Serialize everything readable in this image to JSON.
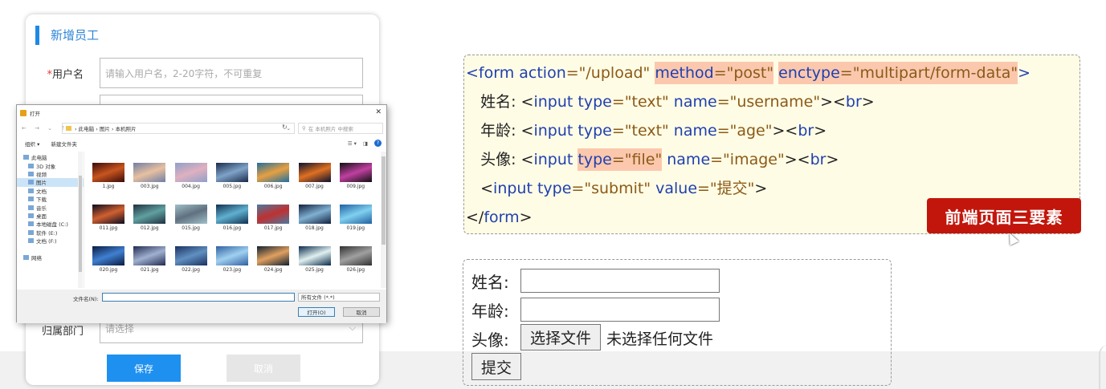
{
  "left_form": {
    "title": "新增员工",
    "username_required": "*",
    "username_label": "用户名",
    "username_placeholder": "请输入用户名，2-20字符，不可重复",
    "dept_label": "归属部门",
    "dept_placeholder": "请选择",
    "save_label": "保存",
    "cancel_label": "取消"
  },
  "dialog": {
    "title": "打开",
    "close": "✕",
    "nav_arrows": "← → ⌄ ↑",
    "breadcrumb": "› 此电脑 › 图片 › 本机照片",
    "search_placeholder": "在 本机照片 中搜索",
    "toolbar_organize": "组织 ▾",
    "toolbar_newfolder": "新建文件夹",
    "sidebar": [
      {
        "label": "此电脑",
        "top": true,
        "sel": false
      },
      {
        "label": "3D 对象",
        "top": false,
        "sel": false
      },
      {
        "label": "视频",
        "top": false,
        "sel": false
      },
      {
        "label": "图片",
        "top": false,
        "sel": true
      },
      {
        "label": "文档",
        "top": false,
        "sel": false
      },
      {
        "label": "下载",
        "top": false,
        "sel": false
      },
      {
        "label": "音乐",
        "top": false,
        "sel": false
      },
      {
        "label": "桌面",
        "top": false,
        "sel": false
      },
      {
        "label": "本地磁盘 (C:)",
        "top": false,
        "sel": false
      },
      {
        "label": "软件 (E:)",
        "top": false,
        "sel": false
      },
      {
        "label": "文档 (F:)",
        "top": false,
        "sel": false
      },
      {
        "label": "",
        "top": false,
        "sel": false
      },
      {
        "label": "网络",
        "top": true,
        "sel": false
      }
    ],
    "files": [
      {
        "name": "1.jpg",
        "colors": [
          "#3a0a0a",
          "#c8551e"
        ]
      },
      {
        "name": "003.jpg",
        "colors": [
          "#6f7fa6",
          "#e8c0a0"
        ]
      },
      {
        "name": "004.jpg",
        "colors": [
          "#8fa0c8",
          "#e0b0c0"
        ]
      },
      {
        "name": "005.jpg",
        "colors": [
          "#1a2a4a",
          "#7fa3c8"
        ]
      },
      {
        "name": "006.jpg",
        "colors": [
          "#1e6fa0",
          "#e8a040"
        ]
      },
      {
        "name": "007.jpg",
        "colors": [
          "#0a1030",
          "#e07020"
        ]
      },
      {
        "name": "009.jpg",
        "colors": [
          "#101010",
          "#c040a0"
        ]
      },
      {
        "name": "011.jpg",
        "colors": [
          "#0a0a20",
          "#d06030"
        ]
      },
      {
        "name": "012.jpg",
        "colors": [
          "#203040",
          "#60a0a0"
        ]
      },
      {
        "name": "015.jpg",
        "colors": [
          "#a0c0c8",
          "#607080"
        ]
      },
      {
        "name": "016.jpg",
        "colors": [
          "#103050",
          "#60b0d0"
        ]
      },
      {
        "name": "017.jpg",
        "colors": [
          "#4a7aa0",
          "#c03030"
        ]
      },
      {
        "name": "018.jpg",
        "colors": [
          "#102040",
          "#80b0d0"
        ]
      },
      {
        "name": "019.jpg",
        "colors": [
          "#2060a0",
          "#80d0f0"
        ]
      },
      {
        "name": "020.jpg",
        "colors": [
          "#0a1a40",
          "#4080d0"
        ]
      },
      {
        "name": "021.jpg",
        "colors": [
          "#202a50",
          "#a0b0d0"
        ]
      },
      {
        "name": "022.jpg",
        "colors": [
          "#1a3060",
          "#6090c0"
        ]
      },
      {
        "name": "023.jpg",
        "colors": [
          "#3060a0",
          "#a0d0f0"
        ]
      },
      {
        "name": "024.jpg",
        "colors": [
          "#102030",
          "#e0a060"
        ]
      },
      {
        "name": "025.jpg",
        "colors": [
          "#0a2a4a",
          "#e0f0f0"
        ]
      },
      {
        "name": "026.jpg",
        "colors": [
          "#303030",
          "#a0a0a0"
        ]
      }
    ],
    "filename_label": "文件名(N):",
    "filetype": "所有文件 (*.*)",
    "open_label": "打开(O)",
    "cancel_label": "取消"
  },
  "code": {
    "l1": {
      "p1": "<form ",
      "p2": "action",
      "p3": "=\"/upload\" ",
      "p4": "method",
      "p5": "=\"post\"",
      "p6": " ",
      "p7": "enctype",
      "p8": "=\"multipart/form-data\"",
      "p9": ">"
    },
    "l2": {
      "p1": "   姓名: <",
      "p2": "input ",
      "p3": "type",
      "p4": "=\"text\" ",
      "p5": "name",
      "p6": "=\"username\"",
      "p7": "><",
      "p8": "br",
      "p9": ">"
    },
    "l3": {
      "p1": "   年龄: <",
      "p2": "input ",
      "p3": "type",
      "p4": "=\"text\" ",
      "p5": "name",
      "p6": "=\"age\"",
      "p7": "><",
      "p8": "br",
      "p9": ">"
    },
    "l4": {
      "p1": "   头像: <",
      "p2": "input ",
      "p3": "type",
      "p4": "=\"file\"",
      "p5": " ",
      "p6": "name",
      "p7": "=\"image\"",
      "p8": "><",
      "p9": "br",
      "p10": ">"
    },
    "l5": {
      "p1": "   <",
      "p2": "input ",
      "p3": "type",
      "p4": "=\"submit\" ",
      "p5": "value",
      "p6": "=\"提交\"",
      "p7": ">"
    },
    "l6": {
      "p1": "</",
      "p2": "form",
      "p3": ">"
    }
  },
  "badge": "前端页面三要素",
  "preview": {
    "name_label": "姓名:",
    "age_label": "年龄:",
    "avatar_label": "头像:",
    "choose_file": "选择文件",
    "no_file": "未选择任何文件",
    "submit": "提交"
  },
  "colors": {
    "accent_blue": "#1e90f0",
    "highlight": "#fbc8ae",
    "badge_red": "#c2160c",
    "code_bg": "#fffce5"
  }
}
